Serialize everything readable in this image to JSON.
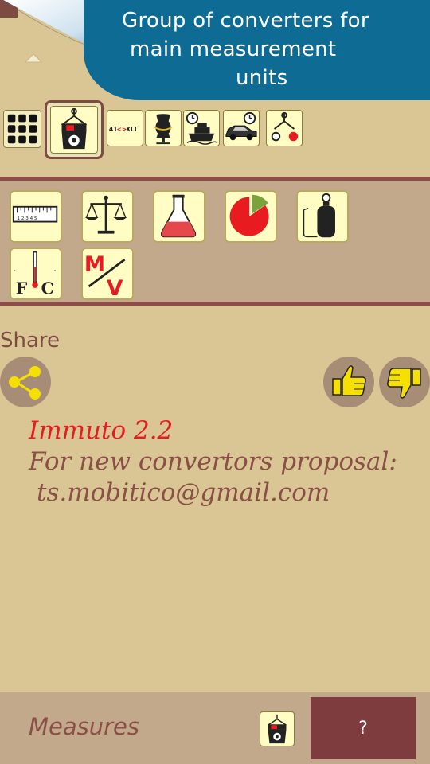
{
  "tooltip": {
    "line1": "Group of converters for",
    "line2": "main measurement",
    "line3": "units"
  },
  "top_row": {
    "items": [
      {
        "name": "all-converters",
        "icon": "grid-icon"
      },
      {
        "name": "measures",
        "icon": "scale-weight-icon",
        "selected": true
      },
      {
        "name": "sizes",
        "icon": "size-conversion-icon",
        "label": "41<->XLI"
      },
      {
        "name": "clothing",
        "icon": "mannequin-icon"
      },
      {
        "name": "transport",
        "icon": "ship-icon"
      },
      {
        "name": "car",
        "icon": "car-icon"
      },
      {
        "name": "other",
        "icon": "hanging-scale-icon"
      }
    ]
  },
  "grid_icons": [
    {
      "name": "length",
      "icon": "ruler-icon",
      "label": "1 2 3 4 5"
    },
    {
      "name": "weight",
      "icon": "balance-scale-icon"
    },
    {
      "name": "volume",
      "icon": "flask-icon"
    },
    {
      "name": "area",
      "icon": "pie-chart-icon"
    },
    {
      "name": "pressure",
      "icon": "gas-cylinder-icon"
    },
    {
      "name": "temperature",
      "icon": "thermometer-icon",
      "label_f": "F",
      "label_c": "C"
    },
    {
      "name": "mass-volume",
      "icon": "mass-volume-icon",
      "label_m": "M",
      "label_v": "V"
    }
  ],
  "share": {
    "label": "Share"
  },
  "info": {
    "version": "Immuto 2.2",
    "proposal": "For new convertors proposal:",
    "email": "ts.mobitico@gmail.com"
  },
  "bottom": {
    "label": "Measures",
    "help": "?"
  },
  "colors": {
    "background": "#d9c694",
    "panel": "#c3a98c",
    "accent": "#8e4b48",
    "tooltip": "#0e6b94",
    "icon_bg": "#fffcc4",
    "red": "#e81c20"
  }
}
